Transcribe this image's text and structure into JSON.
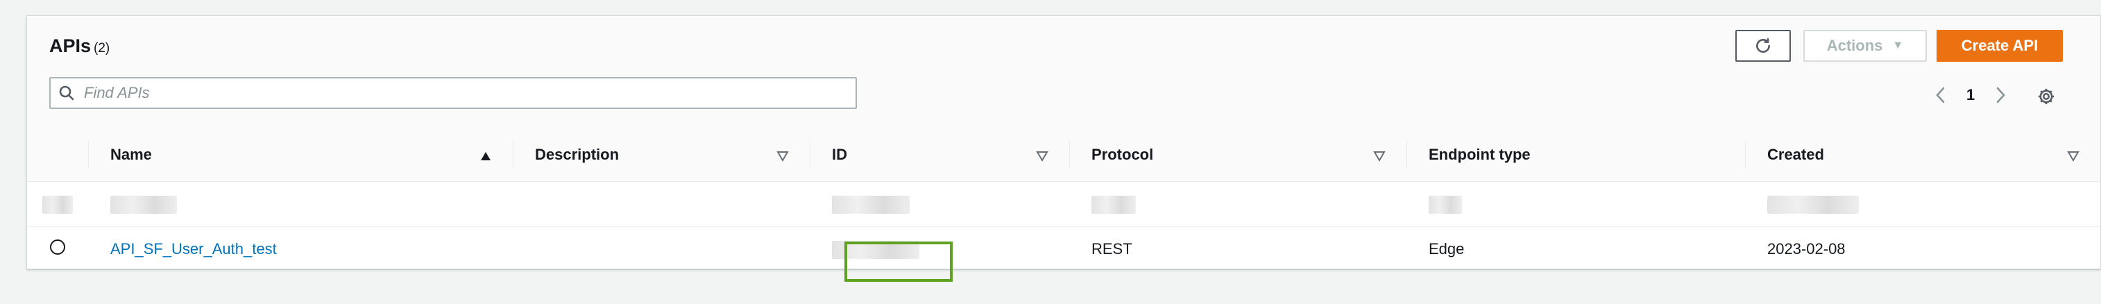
{
  "header": {
    "title": "APIs",
    "count": "(2)",
    "actions_label": "Actions",
    "create_label": "Create API",
    "search_placeholder": "Find APIs",
    "page_number": "1"
  },
  "table": {
    "columns": [
      "Name",
      "Description",
      "ID",
      "Protocol",
      "Endpoint type",
      "Created"
    ],
    "rows": [
      {
        "name": "",
        "description": "",
        "id": "",
        "protocol": "",
        "endpoint_type": "",
        "created": ""
      },
      {
        "name": "API_SF_User_Auth_test",
        "description": "",
        "id": "",
        "protocol": "REST",
        "endpoint_type": "Edge",
        "created": "2023-02-08"
      }
    ]
  },
  "colors": {
    "accent": "#ec7211",
    "link": "#0073bb",
    "highlight": "#5ea21f"
  },
  "icons": [
    "refresh-icon",
    "caret-down-icon",
    "search-icon",
    "chevron-left-icon",
    "chevron-right-icon",
    "gear-icon",
    "sort-asc-icon",
    "sort-desc-icon"
  ]
}
